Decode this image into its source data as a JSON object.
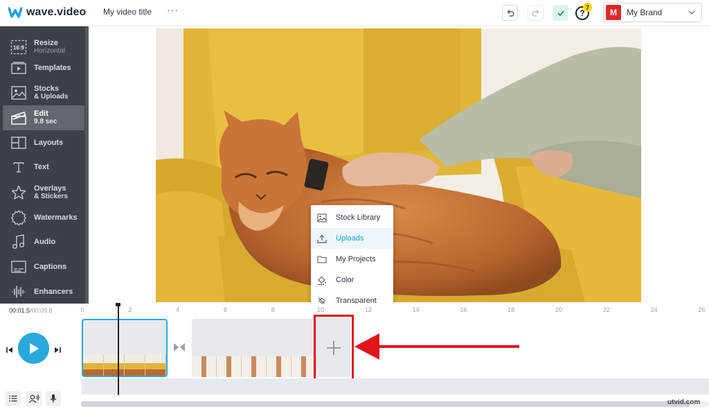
{
  "header": {
    "logo_text": "wave.video",
    "video_title": "My video title",
    "more_label": "···",
    "help_badge": "7",
    "help_mark": "?",
    "brand": {
      "initial": "M",
      "name": "My Brand"
    }
  },
  "sidebar": {
    "items": [
      {
        "label": "Resize",
        "sub": "Horizontal",
        "icon": "resize-icon",
        "badge": "16:9"
      },
      {
        "label": "Templates",
        "sub": "",
        "icon": "templates-icon"
      },
      {
        "label": "Stocks",
        "sub": "& Uploads",
        "icon": "image-icon"
      },
      {
        "label": "Edit",
        "sub": "9.8 sec",
        "icon": "clapperboard-icon",
        "active": true
      },
      {
        "label": "Layouts",
        "sub": "",
        "icon": "layouts-icon"
      },
      {
        "label": "Text",
        "sub": "",
        "icon": "text-icon"
      },
      {
        "label": "Overlays",
        "sub": "& Stickers",
        "icon": "star-icon"
      },
      {
        "label": "Watermarks",
        "sub": "",
        "icon": "watermark-icon"
      },
      {
        "label": "Audio",
        "sub": "",
        "icon": "music-note-icon"
      },
      {
        "label": "Captions",
        "sub": "",
        "icon": "captions-icon"
      },
      {
        "label": "Enhancers",
        "sub": "",
        "icon": "waveform-icon"
      }
    ]
  },
  "menu": {
    "items": [
      {
        "label": "Stock Library",
        "icon": "image-icon"
      },
      {
        "label": "Uploads",
        "icon": "upload-icon",
        "active": true
      },
      {
        "label": "My Projects",
        "icon": "folder-icon"
      },
      {
        "label": "Color",
        "icon": "paint-bucket-icon"
      },
      {
        "label": "Transparent",
        "icon": "no-fill-icon"
      }
    ]
  },
  "timeline": {
    "current_time": "00:01.5",
    "total_time": "/00:09.8",
    "ticks": [
      "0",
      "2",
      "4",
      "6",
      "8",
      "10",
      "12",
      "14",
      "16",
      "18",
      "20",
      "22",
      "24",
      "26"
    ]
  },
  "watermark": "utvid.com",
  "colors": {
    "accent": "#29a8dc",
    "sidebar_bg": "#3c4047",
    "highlight_red": "#e1141c",
    "brand_red": "#e22a2a"
  }
}
